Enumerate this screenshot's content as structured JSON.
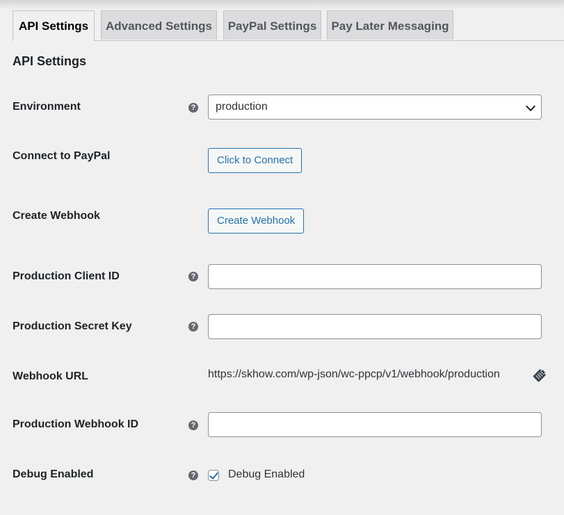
{
  "tabs": [
    {
      "label": "API Settings",
      "active": true
    },
    {
      "label": "Advanced Settings",
      "active": false
    },
    {
      "label": "PayPal Settings",
      "active": false
    },
    {
      "label": "Pay Later Messaging",
      "active": false
    }
  ],
  "section_title": "API Settings",
  "fields": {
    "environment": {
      "label": "Environment",
      "value": "production",
      "help": "?"
    },
    "connect": {
      "label": "Connect to PayPal",
      "button": "Click to Connect"
    },
    "webhook": {
      "label": "Create Webhook",
      "button": "Create Webhook"
    },
    "client_id": {
      "label": "Production Client ID",
      "value": "",
      "help": "?"
    },
    "secret_key": {
      "label": "Production Secret Key",
      "value": "",
      "help": "?"
    },
    "webhook_url": {
      "label": "Webhook URL",
      "value": "https://skhow.com/wp-json/wc-ppcp/v1/webhook/production",
      "icon": "clipboard-icon"
    },
    "webhook_id": {
      "label": "Production Webhook ID",
      "value": "",
      "help": "?"
    },
    "debug": {
      "label": "Debug Enabled",
      "checkbox_label": "Debug Enabled",
      "checked": true,
      "help": "?"
    }
  },
  "colors": {
    "accent": "#2271b1",
    "background": "#f0f0f1"
  }
}
